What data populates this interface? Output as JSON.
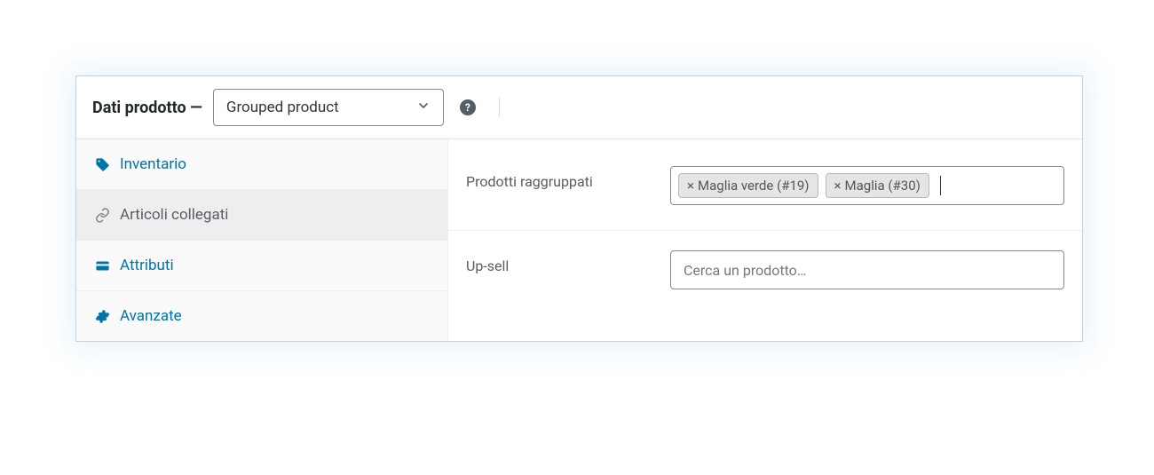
{
  "header": {
    "title": "Dati prodotto —",
    "product_type": "Grouped product"
  },
  "sidebar": {
    "items": [
      {
        "label": "Inventario",
        "icon": "tag"
      },
      {
        "label": "Articoli collegati",
        "icon": "link"
      },
      {
        "label": "Attributi",
        "icon": "card"
      },
      {
        "label": "Avanzate",
        "icon": "gear"
      }
    ]
  },
  "fields": {
    "grouped": {
      "label": "Prodotti raggruppati",
      "tags": [
        {
          "text": "Maglia verde (#19)"
        },
        {
          "text": "Maglia (#30)"
        }
      ]
    },
    "upsell": {
      "label": "Up-sell",
      "placeholder": "Cerca un prodotto…"
    }
  }
}
